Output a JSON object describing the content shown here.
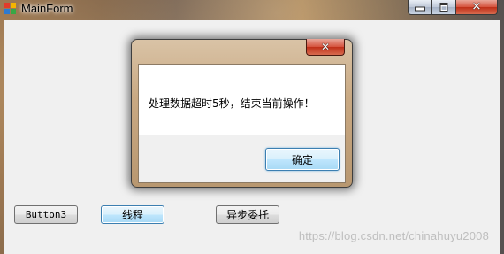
{
  "window": {
    "title": "MainForm"
  },
  "buttons": {
    "button3": "Button3",
    "thread": "线程",
    "async_delegate": "异步委托"
  },
  "message_box": {
    "text": "处理数据超时5秒，结束当前操作！",
    "ok_label": "确定"
  },
  "watermark": "https://blog.csdn.net/chinahuyu2008",
  "colors": {
    "client_background": "#f0f0f0",
    "close_button": "#c7402a",
    "focus_border": "#3c7fb1"
  },
  "icons": {
    "app": "windows-form-icon",
    "minimize": "minimize-icon",
    "maximize": "maximize-icon",
    "close": "close-icon"
  }
}
